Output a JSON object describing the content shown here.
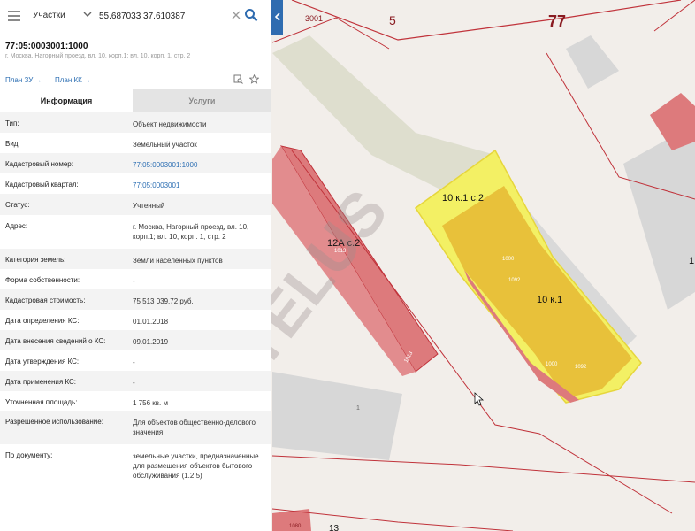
{
  "search": {
    "type_label": "Участки",
    "query": "55.687033 37.610387"
  },
  "object": {
    "number": "77:05:0003001:1000",
    "address_short": "г. Москва, Нагорный проезд, вл. 10, корп.1; вл. 10, корп. 1, стр. 2"
  },
  "links": {
    "plan_zu": "План ЗУ →",
    "plan_kk": "План КК →"
  },
  "tabs": {
    "info": "Информация",
    "services": "Услуги"
  },
  "properties": [
    {
      "label": "Тип:",
      "value": "Объект недвижимости"
    },
    {
      "label": "Вид:",
      "value": "Земельный участок"
    },
    {
      "label": "Кадастровый номер:",
      "value": "77:05:0003001:1000"
    },
    {
      "label": "Кадастровый квартал:",
      "value": "77:05:0003001"
    },
    {
      "label": "Статус:",
      "value": "Учтенный"
    },
    {
      "label": "Адрес:",
      "value": "г. Москва, Нагорный проезд, вл. 10, корп.1; вл. 10, корп. 1, стр. 2"
    },
    {
      "label": "Категория земель:",
      "value": "Земли населённых пунктов"
    },
    {
      "label": "Форма собственности:",
      "value": "-"
    },
    {
      "label": "Кадастровая стоимость:",
      "value": "75 513 039,72 руб."
    },
    {
      "label": "Дата определения КС:",
      "value": "01.01.2018"
    },
    {
      "label": "Дата внесения сведений о КС:",
      "value": "09.01.2019"
    },
    {
      "label": "Дата утверждения КС:",
      "value": "-"
    },
    {
      "label": "Дата применения КС:",
      "value": "-"
    },
    {
      "label": "Уточненная площадь:",
      "value": "1 756 кв. м"
    },
    {
      "label": "Разрешенное использование:",
      "value": "Для объектов общественно-делового значения"
    },
    {
      "label": "По документу:",
      "value": "земельные участки, предназначенные для размещения объектов бытового обслуживания (1.2.5)"
    }
  ],
  "map": {
    "labels": {
      "q3001": "3001",
      "q5": "5",
      "q77": "77",
      "b10k1s2": "10 к.1 с.2",
      "b10k1": "10 к.1",
      "b12as2": "12А с.2",
      "n1000a": "1000",
      "n1092a": "1092",
      "n1000b": "1000",
      "n1092b": "1092",
      "n1013a": "1013",
      "n1013b": "1013",
      "n1": "1",
      "n1080": "1080",
      "n13": "13",
      "right1": "1",
      "watermark": "TELUS"
    },
    "colors": {
      "parcel_fill": "#e8c13a",
      "parcel_outline": "#f3f064",
      "building_red": "#dd7a7c",
      "boundary": "#c0323a",
      "accent_blue": "#2f6cb0"
    }
  }
}
